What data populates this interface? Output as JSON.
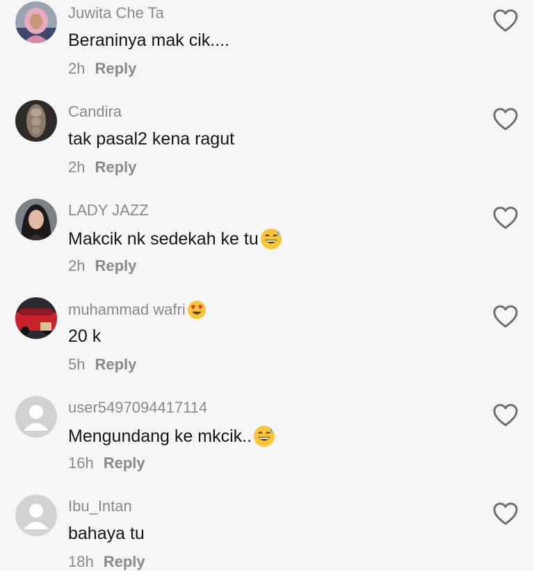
{
  "reply_label": "Reply",
  "comments": [
    {
      "user": "Juwita Che Ta",
      "text": "Beraninya mak cik....",
      "time": "2h",
      "avatar": "photo-hijab",
      "user_emoji": "",
      "text_emoji": ""
    },
    {
      "user": "Candira",
      "text": "tak pasal2 kena ragut",
      "time": "2h",
      "avatar": "photo-braid",
      "user_emoji": "",
      "text_emoji": ""
    },
    {
      "user": "LADY JAZZ",
      "text": "Makcik nk sedekah ke tu",
      "time": "2h",
      "avatar": "photo-woman",
      "user_emoji": "",
      "text_emoji": "grinning-sweat-emoji"
    },
    {
      "user": "muhammad wafri",
      "text": "20 k",
      "time": "5h",
      "avatar": "photo-car",
      "user_emoji": "heart-eyes-emoji",
      "text_emoji": ""
    },
    {
      "user": "user5497094417114",
      "text": "Mengundang ke mkcik..",
      "time": "16h",
      "avatar": "default-user-icon",
      "user_emoji": "",
      "text_emoji": "grinning-sweat-emoji"
    },
    {
      "user": "Ibu_Intan",
      "text": "bahaya tu",
      "time": "18h",
      "avatar": "default-user-icon",
      "user_emoji": "",
      "text_emoji": ""
    }
  ]
}
